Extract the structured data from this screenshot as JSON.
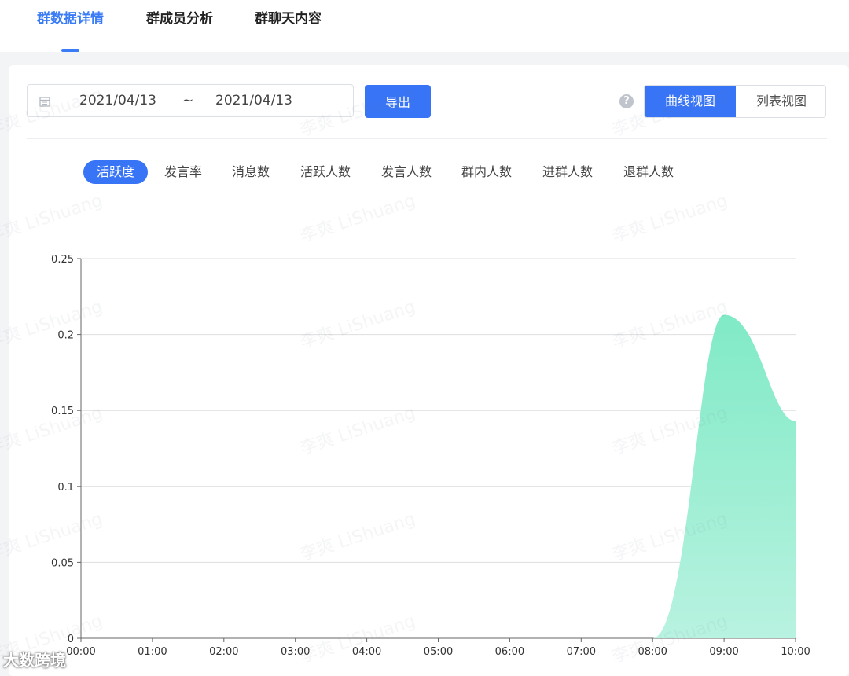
{
  "tabs": [
    {
      "label": "群数据详情",
      "active": true
    },
    {
      "label": "群成员分析",
      "active": false
    },
    {
      "label": "群聊天内容",
      "active": false
    }
  ],
  "filters": {
    "start_date": "2021/04/13",
    "separator": "~",
    "end_date": "2021/04/13",
    "export_label": "导出",
    "help_icon": "?",
    "views": [
      {
        "label": "曲线视图",
        "active": true
      },
      {
        "label": "列表视图",
        "active": false
      }
    ]
  },
  "metrics": [
    {
      "label": "活跃度",
      "active": true
    },
    {
      "label": "发言率",
      "active": false
    },
    {
      "label": "消息数",
      "active": false
    },
    {
      "label": "活跃人数",
      "active": false
    },
    {
      "label": "发言人数",
      "active": false
    },
    {
      "label": "群内人数",
      "active": false
    },
    {
      "label": "进群人数",
      "active": false
    },
    {
      "label": "退群人数",
      "active": false
    }
  ],
  "chart_data": {
    "type": "area",
    "x": [
      "00:00",
      "01:00",
      "02:00",
      "03:00",
      "04:00",
      "05:00",
      "06:00",
      "07:00",
      "08:00",
      "09:00",
      "10:00"
    ],
    "ylim": [
      0,
      0.25
    ],
    "yticks": [
      "0",
      "0.05",
      "0.1",
      "0.15",
      "0.2",
      "0.25"
    ],
    "series": [
      {
        "values": [
          0,
          0,
          0,
          0,
          0,
          0,
          0,
          0,
          0,
          0.213,
          0.143
        ]
      }
    ],
    "color": "#8eeacb",
    "grid": true,
    "smooth": true
  },
  "watermark_text": "李爽 LiShuang",
  "footer_logo": "大数跨境"
}
